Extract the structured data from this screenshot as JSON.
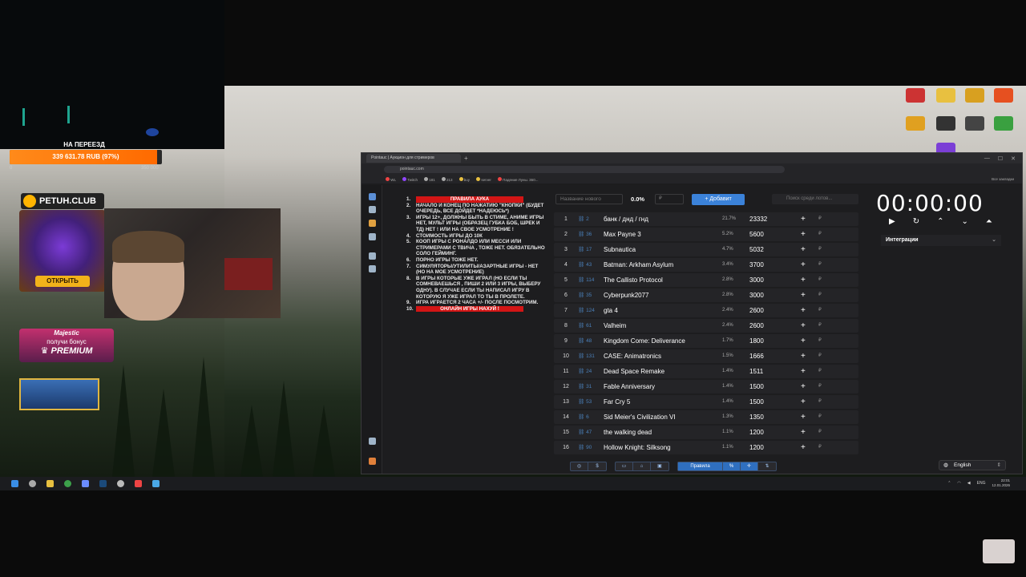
{
  "overlay": {
    "goal_title": "НА ПЕРЕЕЗД",
    "goal_text": "339 631.78 RUB (97%)",
    "goal_fraction": 0.97,
    "goal_min": "0",
    "goal_max": "350 000",
    "petuh_label": "PETUH.CLUB",
    "petuh_button": "ОТКРЫТЬ",
    "majestic_brand": "Majestic",
    "majestic_line": "получи бонус",
    "majestic_premium": "♛ PREMIUM"
  },
  "browser": {
    "tab_title": "Pointauc | Аукцион для стримеров",
    "url": "pointauc.com",
    "bookmarks": [
      "WL",
      "Twitch",
      "181",
      "213",
      "buy",
      "server",
      "Падение Луны. 360..."
    ],
    "bookmarks_right": "Все закладки"
  },
  "controls": {
    "name_placeholder": "Название нового",
    "percent": "0.0%",
    "amount_placeholder": "₽",
    "add_label": "+ Добавит",
    "search_placeholder": "Поиск среди лотов..."
  },
  "rules": {
    "header": "ПРАВИЛА АУКА",
    "items": [
      {
        "n": "2.",
        "text": "НАЧАЛО И КОНЕЦ ПО НАЖАТИЮ \"КНОПКИ\" (БУДЕТ ОЧЕРЕДЬ, ВСЕ ДОЙДЕТ *НАДЕЮСЬ*)"
      },
      {
        "n": "3.",
        "text": "ИГРЫ 12+, ДОЛЖНЫ БЫТЬ В СТИМЕ, АНИМЕ ИГРЫ НЕТ, МУЛЬТ ИГРЫ (ОБРАЗЕЦ ГУБКА БОБ, ШРЕК И ТД) НЕТ ! ИЛИ НА СВОЕ УСМОТРЕНИЕ !"
      },
      {
        "n": "4.",
        "text": "СТОИМОСТЬ ИГРЫ ДО 10К"
      },
      {
        "n": "5.",
        "text": "КООП ИГРЫ С РОНАЛДО ИЛИ МЕССИ ИЛИ СТРИМЕРАМИ С ТВИЧА , ТОЖЕ НЕТ. ОБЯЗАТЕЛЬНО СОЛО ГЕЙМИНГ."
      },
      {
        "n": "6.",
        "text": "ПОРНО ИГРЫ ТОЖЕ НЕТ."
      },
      {
        "n": "7.",
        "text": "СИМУЛЯТОРЫ/УТИЛИТЫ/АЗАРТНЫЕ ИГРЫ - НЕТ (НО НА МОЕ УСМОТРЕНИЕ)"
      },
      {
        "n": "8.",
        "text": "В ИГРЫ КОТОРЫЕ УЖЕ ИГРАЛ (НО ЕСЛИ ТЫ СОМНЕВАЕШЬСЯ , ПИШИ 2 ИЛИ 3 ИГРЫ, ВЫБЕРУ ОДНУ). В СЛУЧАЕ ЕСЛИ ТЫ НАПИСАЛ ИГРУ В КОТОРУЮ Я УЖЕ ИГРАЛ ТО ТЫ В ПРОЛЕТЕ."
      },
      {
        "n": "9.",
        "text": "ИГРА ИГРАЕТСЯ 2 ЧАСА +/- ПОСЛЕ ПОСМОТРИМ."
      }
    ],
    "footer_num": "10.",
    "footer": "ОНЛАЙН ИГРЫ НАХУЙ !"
  },
  "lots": [
    {
      "idx": "1",
      "link": "2",
      "name": "банк / днд / гнд",
      "pct": "21.7%",
      "amount": "23332"
    },
    {
      "idx": "2",
      "link": "36",
      "name": "Max Payne 3",
      "pct": "5.2%",
      "amount": "5600"
    },
    {
      "idx": "3",
      "link": "17",
      "name": "Subnautica",
      "pct": "4.7%",
      "amount": "5032"
    },
    {
      "idx": "4",
      "link": "43",
      "name": "Batman: Arkham Asylum",
      "pct": "3.4%",
      "amount": "3700"
    },
    {
      "idx": "5",
      "link": "114",
      "name": "The Callisto Protocol",
      "pct": "2.8%",
      "amount": "3000"
    },
    {
      "idx": "6",
      "link": "35",
      "name": "Cyberpunk2077",
      "pct": "2.8%",
      "amount": "3000"
    },
    {
      "idx": "7",
      "link": "124",
      "name": "gta 4",
      "pct": "2.4%",
      "amount": "2600"
    },
    {
      "idx": "8",
      "link": "61",
      "name": "Valheim",
      "pct": "2.4%",
      "amount": "2600"
    },
    {
      "idx": "9",
      "link": "48",
      "name": "Kingdom Come: Deliverance",
      "pct": "1.7%",
      "amount": "1800"
    },
    {
      "idx": "10",
      "link": "131",
      "name": "CASE: Animatronics",
      "pct": "1.5%",
      "amount": "1666"
    },
    {
      "idx": "11",
      "link": "24",
      "name": "Dead Space Remake",
      "pct": "1.4%",
      "amount": "1511"
    },
    {
      "idx": "12",
      "link": "31",
      "name": "Fable Anniversary",
      "pct": "1.4%",
      "amount": "1500"
    },
    {
      "idx": "13",
      "link": "53",
      "name": "Far Cry 5",
      "pct": "1.4%",
      "amount": "1500"
    },
    {
      "idx": "14",
      "link": "6",
      "name": "Sid Meier's Civilization VI",
      "pct": "1.3%",
      "amount": "1350"
    },
    {
      "idx": "15",
      "link": "47",
      "name": "the walking dead",
      "pct": "1.1%",
      "amount": "1200"
    },
    {
      "idx": "16",
      "link": "90",
      "name": "Hollow Knight: Silksong",
      "pct": "1.1%",
      "amount": "1200"
    }
  ],
  "timer": {
    "value": "00:00:00",
    "integrations_label": "Интеграции",
    "language": "English"
  },
  "toolbar": {
    "rules_label": "Правила"
  },
  "taskbar": {
    "lang": "ENG",
    "time": "22:01",
    "date": "12.01.2026"
  }
}
